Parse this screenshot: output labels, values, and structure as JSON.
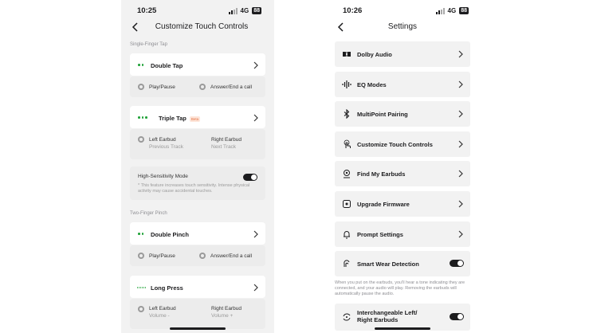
{
  "left": {
    "status": {
      "time": "10:25",
      "network": "4G",
      "battery": "88"
    },
    "title": "Customize Touch Controls",
    "single_section": "Single-Finger Tap",
    "double_tap": {
      "title": "Double Tap",
      "opt1": "Play/Pause",
      "opt2": "Answer/End a call"
    },
    "triple_tap": {
      "title": "Triple Tap",
      "badge": "Beta",
      "left_label": "Left Earbud",
      "left_value": "Previous Track",
      "right_label": "Right Earbud",
      "right_value": "Next Track"
    },
    "high_sensitivity": {
      "title": "High-Sensitivity Mode",
      "note": "* This feature increases touch sensitivity. Intense physical activity may cause accidental touches.",
      "enabled": true
    },
    "two_section": "Two-Finger Pinch",
    "double_pinch": {
      "title": "Double Pinch",
      "opt1": "Play/Pause",
      "opt2": "Answer/End a call"
    },
    "long_press": {
      "title": "Long Press",
      "left_label": "Left Earbud",
      "left_value": "Volume -",
      "right_label": "Right Earbud",
      "right_value": "Volume +"
    }
  },
  "right": {
    "status": {
      "time": "10:26",
      "network": "4G",
      "battery": "88"
    },
    "title": "Settings",
    "items": [
      {
        "label": "Dolby Audio",
        "icon": "dolby-icon"
      },
      {
        "label": "EQ Modes",
        "icon": "equalizer-icon"
      },
      {
        "label": "MultiPoint Pairing",
        "icon": "bluetooth-icon"
      },
      {
        "label": "Customize Touch Controls",
        "icon": "touch-icon"
      },
      {
        "label": "Find My Earbuds",
        "icon": "location-icon"
      },
      {
        "label": "Upgrade Firmware",
        "icon": "firmware-icon"
      },
      {
        "label": "Prompt Settings",
        "icon": "bell-icon"
      }
    ],
    "smart_wear": {
      "label": "Smart Wear Detection",
      "enabled": true,
      "note": "When you put on the earbuds, you'll hear a tone indicating they are connected, and your audio will play. Removing the earbuds will automatically pause the audio."
    },
    "interchangeable": {
      "label1": "Interchangeable Left/",
      "label2": "Right Earbuds",
      "enabled": true
    }
  },
  "colors": {
    "accent_green": "#22a33a",
    "toggle_on": "#1c1c1e",
    "beta_badge": "#e57244"
  }
}
